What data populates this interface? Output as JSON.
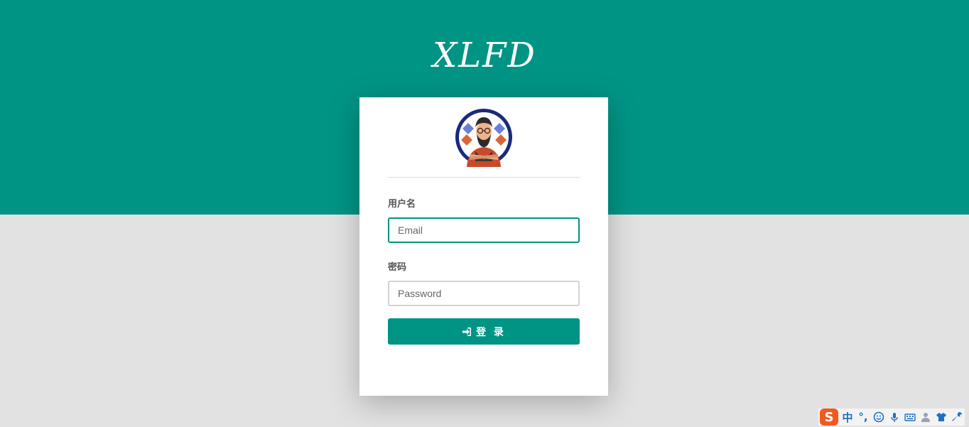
{
  "brand": {
    "title": "XLFD"
  },
  "login_form": {
    "username_label": "用户名",
    "username_placeholder": "Email",
    "password_label": "密码",
    "password_placeholder": "Password",
    "submit_label": "登 录"
  },
  "ime_toolbar": {
    "logo": "S",
    "mode": "中",
    "punct": "°,",
    "icons": [
      "emoji-icon",
      "microphone-icon",
      "keyboard-icon",
      "user-icon",
      "skin-icon",
      "wrench-icon"
    ]
  },
  "colors": {
    "primary": "#009485",
    "background": "#e2e2e2",
    "card": "#ffffff"
  }
}
